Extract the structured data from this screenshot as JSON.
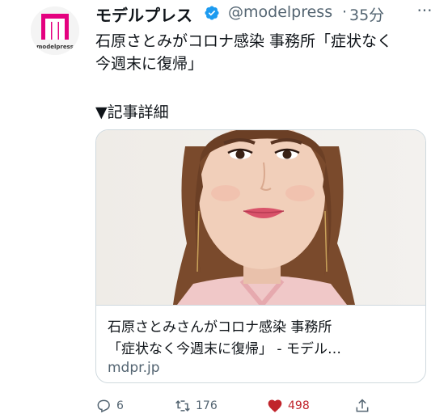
{
  "tweet": {
    "author": "モデルプレス",
    "handle": "@modelpress",
    "dot": "·",
    "time": "35分",
    "more": "···",
    "logo_text": "modelpress",
    "text_line1": "石原さとみがコロナ感染 事務所「症状なく",
    "text_line2": "今週末に復帰」",
    "text_line3": "▼記事詳細"
  },
  "card": {
    "title_line1": "石原さとみさんがコロナ感染 事務所",
    "title_line2": "「症状なく今週末に復帰」 - モデル…",
    "domain": "mdpr.jp"
  },
  "actions": {
    "replies": "6",
    "retweets": "176",
    "likes": "498"
  },
  "colors": {
    "brand": "#e4007f",
    "verified": "#1d9bf0",
    "like": "#f91880",
    "muted": "#536471"
  }
}
